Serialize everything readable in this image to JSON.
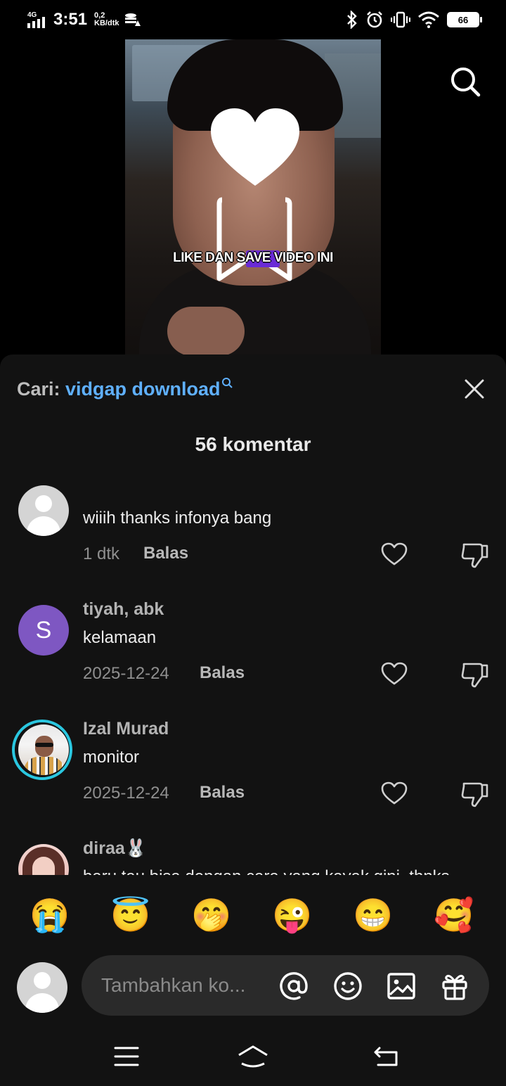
{
  "status_bar": {
    "network_type": "4G",
    "time": "3:51",
    "speed_value": "0,2",
    "speed_unit": "KB/dtk",
    "battery": "66"
  },
  "video": {
    "caption": "LIKE DAN SAVE VIDEO INI"
  },
  "sheet": {
    "search_prefix": "Cari:",
    "search_query": "vidgap download",
    "comment_count": "56 komentar"
  },
  "comments": [
    {
      "username": "",
      "text": "wiiih thanks infonya bang",
      "time": "1 dtk",
      "reply": "Balas",
      "avatar": "default"
    },
    {
      "username": "tiyah, abk",
      "text": "kelamaan",
      "time": "2025-12-24",
      "reply": "Balas",
      "avatar": "S"
    },
    {
      "username": "Izal Murad",
      "text": "monitor",
      "time": "2025-12-24",
      "reply": "Balas",
      "avatar": "photo"
    },
    {
      "username": "diraa🐰",
      "text": "baru tau bisa dengan cara yang kayak gini, thnks",
      "avatar": "photo"
    }
  ],
  "emojis": [
    "😭",
    "😇",
    "🤭",
    "😜",
    "😁",
    "🥰"
  ],
  "input": {
    "placeholder": "Tambahkan ko..."
  },
  "icons": {
    "search": "search-icon",
    "close": "close-icon",
    "like": "heart-icon",
    "dislike": "thumbs-down-icon",
    "mention": "at-icon",
    "emoji": "smiley-icon",
    "image": "image-icon",
    "gift": "gift-icon",
    "menu": "menu-icon",
    "home": "home-icon",
    "back": "back-icon"
  },
  "colors": {
    "sheet_bg": "#121212",
    "query_link": "#5fb0ff",
    "avatar_s": "#7e57c2",
    "story_ring": "#2ac7e0"
  }
}
